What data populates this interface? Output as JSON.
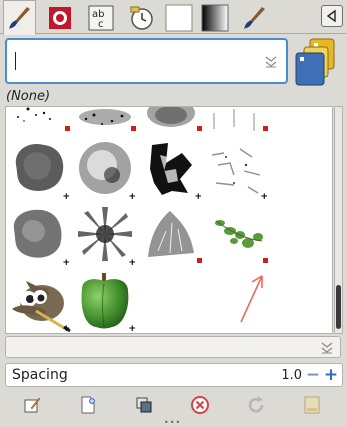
{
  "tabs": [
    {
      "icon": "paintbrush-icon",
      "active": true
    },
    {
      "icon": "pattern-icon"
    },
    {
      "icon": "font-icon"
    },
    {
      "icon": "document-history-icon"
    },
    {
      "icon": "white-swatch-icon"
    },
    {
      "icon": "gradient-icon"
    },
    {
      "icon": "paintbrush-alt-icon"
    }
  ],
  "search": {
    "placeholder": ""
  },
  "filter_label": "(None)",
  "brushes": [
    {
      "name": "splatter-top-1",
      "row": 0,
      "col": 0
    },
    {
      "name": "splatter-top-2",
      "row": 0,
      "col": 1
    },
    {
      "name": "splatter-top-3",
      "row": 0,
      "col": 2
    },
    {
      "name": "splatter-top-4",
      "row": 0,
      "col": 3
    },
    {
      "name": "grunge-1",
      "row": 1,
      "col": 0
    },
    {
      "name": "grunge-2",
      "row": 1,
      "col": 1
    },
    {
      "name": "grunge-3",
      "row": 1,
      "col": 2
    },
    {
      "name": "grunge-4",
      "row": 1,
      "col": 3
    },
    {
      "name": "grunge-5",
      "row": 2,
      "col": 0
    },
    {
      "name": "star-blur",
      "row": 2,
      "col": 1
    },
    {
      "name": "foliage",
      "row": 2,
      "col": 2
    },
    {
      "name": "leaves",
      "row": 2,
      "col": 3
    },
    {
      "name": "gimp-mascot",
      "row": 3,
      "col": 0
    },
    {
      "name": "pepper",
      "row": 3,
      "col": 1
    }
  ],
  "spacing": {
    "label": "Spacing",
    "value": "1.0"
  },
  "bottom_actions": [
    "edit-brush-icon",
    "new-brush-icon",
    "duplicate-brush-icon",
    "delete-brush-icon",
    "refresh-brushes-icon",
    "open-as-image-icon"
  ],
  "colors": {
    "accent": "#4b8ad6",
    "annotation": "#e86a5a"
  }
}
